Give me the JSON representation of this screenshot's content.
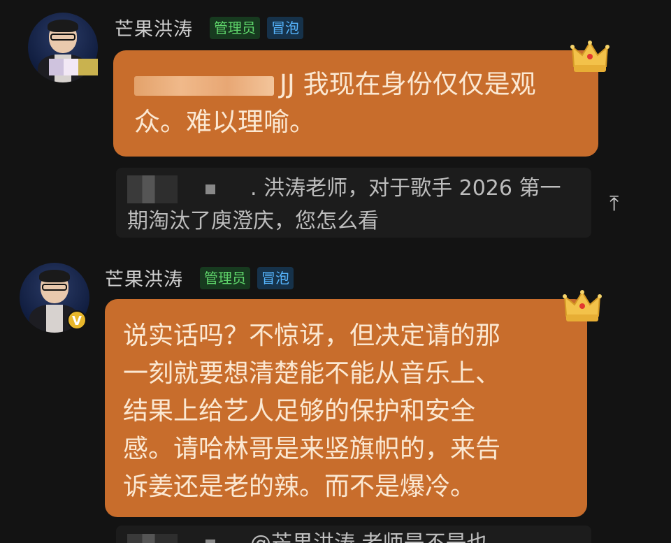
{
  "comment1": {
    "username": "芒果洪涛",
    "badges": {
      "admin": "管理员",
      "bubble": "冒泡"
    },
    "message_line1": "JJ 我现在身份仅仅是观",
    "message_line2": "众。难以理喻。",
    "quoted_reply_line1": ". 洪涛老师，对于歌手 2026 第一",
    "quoted_reply_line2": "期淘汰了庾澄庆，您怎么看"
  },
  "comment2": {
    "username": "芒果洪涛",
    "badges": {
      "admin": "管理员",
      "bubble": "冒泡"
    },
    "message_lines": [
      "说实话吗？不惊讶，但决定请的那",
      "一刻就要想清楚能不能从音乐上、",
      "结果上给艺人足够的保护和安全",
      "感。请哈林哥是来竖旗帜的，来告",
      "诉姜还是老的辣。而不是爆冷。"
    ],
    "verified_badge": "V",
    "quoted_reply_partial": "@芒果洪涛 老师是不是也"
  },
  "icons": {
    "crown": "crown-icon",
    "scroll_up": "arrow-up-icon"
  },
  "colors": {
    "bubble": "#c86d2c",
    "bubble_text": "#fbe8d2",
    "admin_badge_text": "#5fd66b",
    "bubble_badge_text": "#57b6ff",
    "background": "#131313"
  }
}
